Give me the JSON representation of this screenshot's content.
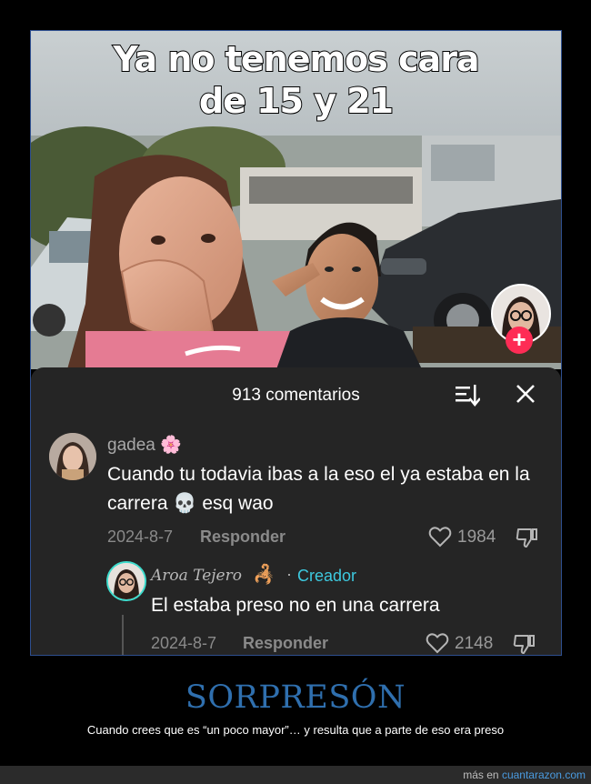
{
  "meme": {
    "overlay_title": "Ya no tenemos cara de 15 y 21"
  },
  "comments": {
    "header": "913 comentarios",
    "items": [
      {
        "username": "gadea 🌸",
        "text": "Cuando tu todavia ibas a la eso el ya estaba en la carrera 💀 esq wao",
        "date": "2024-8-7",
        "reply_label": "Responder",
        "likes": "1984"
      }
    ],
    "reply": {
      "username": "Aroa Tejero",
      "user_emoji": "🦂",
      "separator": "·",
      "badge": "Creador",
      "text": "El estaba preso no en una carrera",
      "date": "2024-8-7",
      "reply_label": "Responder",
      "likes": "2148"
    }
  },
  "caption": {
    "title": "SORPRESÓN",
    "subtitle": "Cuando crees que es “un poco mayor”… y resulta que a parte de eso era preso"
  },
  "footer": {
    "prefix": "más en",
    "site": "cuantarazon.com"
  },
  "icons": {
    "sort": "sort-icon",
    "close": "close-icon",
    "like": "heart-icon",
    "dislike": "thumbs-down-icon",
    "follow": "plus-icon"
  },
  "colors": {
    "sheet_bg": "#252525",
    "creator_badge": "#3dc9df",
    "follow_badge": "#fe2c55",
    "caption_title": "#2f6fae",
    "link": "#4a9be0"
  }
}
